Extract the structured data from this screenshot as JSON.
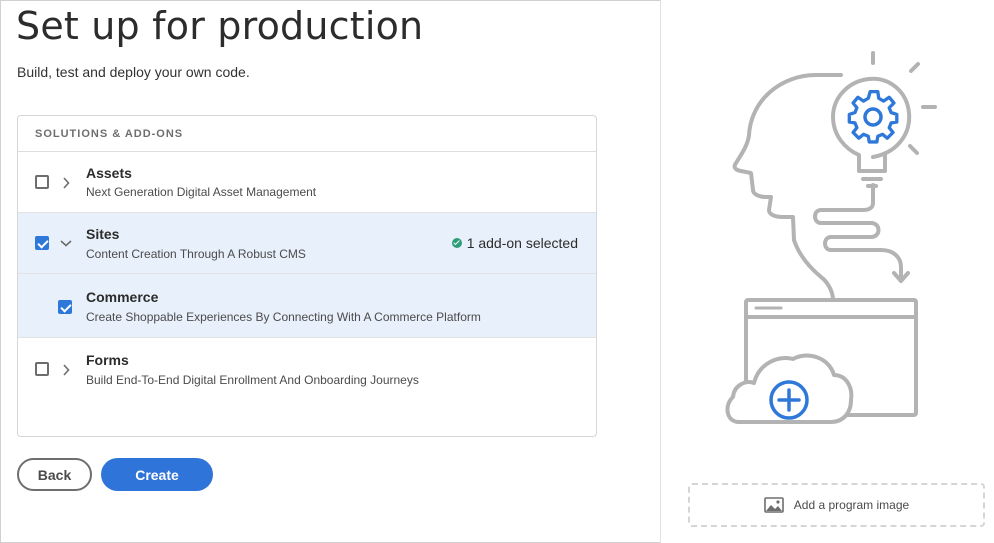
{
  "page": {
    "title": "Set up for production",
    "subtitle": "Build, test and deploy your own code."
  },
  "panel": {
    "header": "SOLUTIONS & ADD-ONS",
    "items": [
      {
        "name": "Assets",
        "description": "Next Generation Digital Asset Management",
        "checked": false,
        "expanded": false
      },
      {
        "name": "Sites",
        "description": "Content Creation Through A Robust CMS",
        "checked": true,
        "expanded": true,
        "status": "1 add-on selected"
      },
      {
        "name": "Commerce",
        "description": "Create Shoppable Experiences By Connecting With A Commerce Platform",
        "checked": true,
        "addon": true
      },
      {
        "name": "Forms",
        "description": "Build End-To-End Digital Enrollment And Onboarding Journeys",
        "checked": false,
        "expanded": false
      }
    ]
  },
  "buttons": {
    "back": "Back",
    "create": "Create"
  },
  "sidebar": {
    "add_image_label": "Add a program image"
  },
  "colors": {
    "accent": "#2f74d8",
    "selected_row": "#e8f0fb",
    "success": "#2d9d78",
    "illustration_gray": "#b3b3b3",
    "illustration_blue": "#2e78da"
  }
}
